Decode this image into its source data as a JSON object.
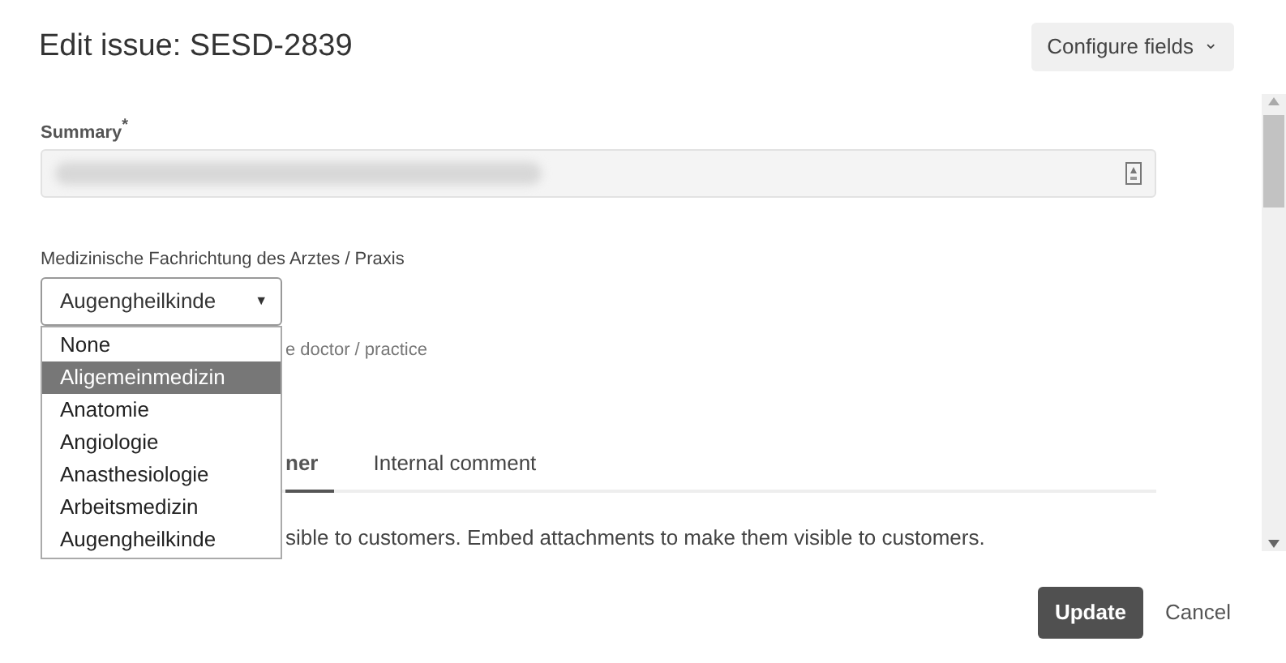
{
  "title": "Edit issue: SESD-2839",
  "configure_button": {
    "label": "Configure fields",
    "caret": "⌄"
  },
  "summary": {
    "label": "Summary",
    "required_mark": "*"
  },
  "specialty": {
    "label": "Medizinische Fachrichtung des Arztes / Praxis",
    "value": "Augengheilkinde",
    "caret": "▼",
    "expanded": true,
    "help_text": "e doctor / practice",
    "options": [
      {
        "label": "None",
        "highlighted": false
      },
      {
        "label": "Aligemeinmedizin",
        "highlighted": true
      },
      {
        "label": "Anatomie",
        "highlighted": false
      },
      {
        "label": "Angiologie",
        "highlighted": false
      },
      {
        "label": "Anasthesiologie",
        "highlighted": false
      },
      {
        "label": "Arbeitsmedizin",
        "highlighted": false
      },
      {
        "label": "Augengheilkinde",
        "highlighted": false
      }
    ]
  },
  "comment_tabs": [
    {
      "label": "ner",
      "selected": true
    },
    {
      "label": "Internal comment",
      "selected": false
    }
  ],
  "comment_note": "sible to customers. Embed attachments to make them visible to customers.",
  "buttons": {
    "update": "Update",
    "cancel": "Cancel"
  }
}
